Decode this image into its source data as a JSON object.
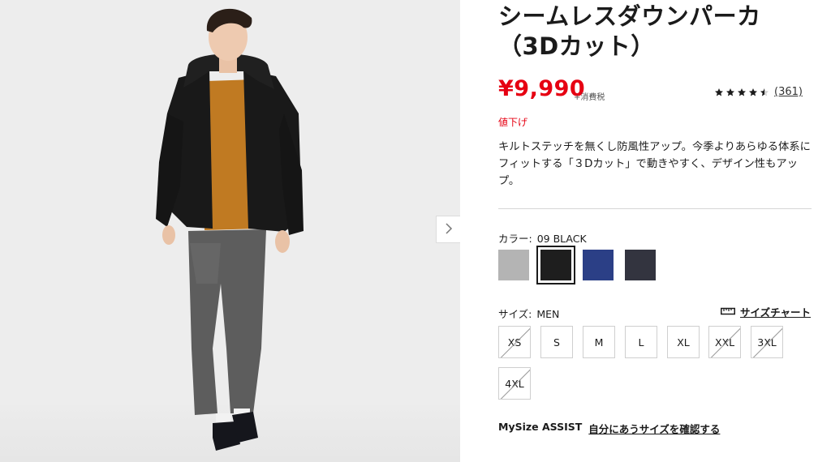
{
  "product": {
    "title_line1": "シームレスダウンパーカ",
    "title_line2": "（3Dカット）",
    "price": "¥9,990",
    "tax_note": "+消費税",
    "rating_count": "(361)",
    "rating_value": 4.5,
    "discount_label": "値下げ",
    "description": "キルトステッチを無くし防風性アップ。今季よりあらゆる体系にフィットする「３Dカット」で動きやすく、デザイン性もアップ。"
  },
  "color": {
    "label": "カラー:",
    "selected": "09 BLACK",
    "swatches": [
      {
        "name": "gray",
        "hex": "#b4b4b4"
      },
      {
        "name": "black",
        "hex": "#1e1e1e"
      },
      {
        "name": "blue",
        "hex": "#2b3f86"
      },
      {
        "name": "navy",
        "hex": "#33343f"
      }
    ]
  },
  "size": {
    "label": "サイズ:",
    "selected": "MEN",
    "chart_link": "サイズチャート",
    "options": [
      "XS",
      "S",
      "M",
      "L",
      "XL",
      "XXL",
      "3XL",
      "4XL"
    ],
    "unavailable": [
      "XS",
      "XXL",
      "3XL",
      "4XL"
    ]
  },
  "mysize": {
    "brand": "MySize ASSIST",
    "link": "自分にあうサイズを確認する"
  },
  "nav": {
    "next_icon": "chevron-right-icon"
  }
}
